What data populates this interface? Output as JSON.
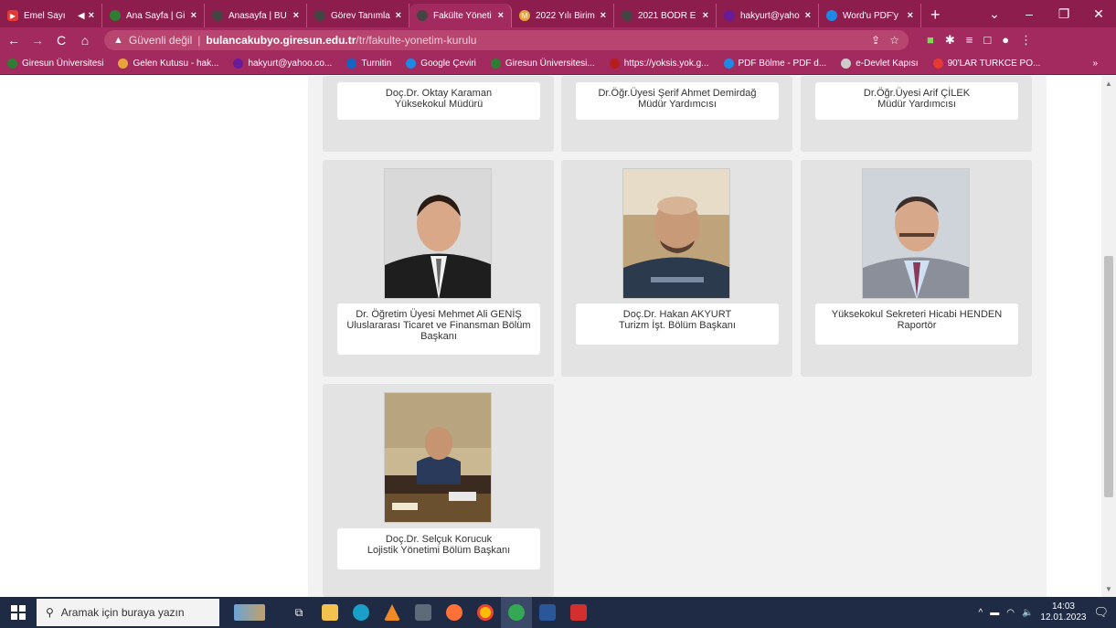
{
  "browser": {
    "tabs": [
      {
        "title": "Emel Sayı",
        "icon_color": "#e53935",
        "extra": "◀"
      },
      {
        "title": "Ana Sayfa | Gi",
        "icon_color": "#2e7d32"
      },
      {
        "title": "Anasayfa | BU",
        "icon_color": "#444444"
      },
      {
        "title": "Görev Tanımla",
        "icon_color": "#444444"
      },
      {
        "title": "Fakülte Yöneti",
        "icon_color": "#444444",
        "active": true
      },
      {
        "title": "2022 Yılı Birim",
        "icon_color": "#e8a33d"
      },
      {
        "title": "2021 BÖDR E",
        "icon_color": "#444444"
      },
      {
        "title": "hakyurt@yaho",
        "icon_color": "#6a1b9a"
      },
      {
        "title": "Word'u PDF'y",
        "icon_color": "#1e88e5"
      }
    ],
    "new_tab": "+",
    "address": {
      "warning_label": "Güvenli değil",
      "host": "bulancakubyo.giresun.edu.tr",
      "path": "/tr/fakulte-yonetim-kurulu"
    },
    "bookmarks": [
      {
        "label": "Giresun Üniversitesi",
        "icon_color": "#2e7d32"
      },
      {
        "label": "Gelen Kutusu - hak...",
        "icon_color": "#e8a33d"
      },
      {
        "label": "hakyurt@yahoo.co...",
        "icon_color": "#6a1b9a"
      },
      {
        "label": "Turnitin",
        "icon_color": "#1565c0"
      },
      {
        "label": "Google Çeviri",
        "icon_color": "#1e88e5"
      },
      {
        "label": "Giresun Üniversitesi...",
        "icon_color": "#2e7d32"
      },
      {
        "label": "https://yoksis.yok.g...",
        "icon_color": "#b71c1c"
      },
      {
        "label": "PDF Bölme - PDF d...",
        "icon_color": "#1e88e5"
      },
      {
        "label": "e-Devlet Kapısı",
        "icon_color": "#cccccc"
      },
      {
        "label": "90'LAR TURKCE PO...",
        "icon_color": "#e53935"
      }
    ],
    "bookmarks_more": "»"
  },
  "page": {
    "top_row": [
      {
        "line1": "Doç.Dr. Oktay Karaman",
        "line2": "Yüksekokul Müdürü"
      },
      {
        "line1": "Dr.Öğr.Üyesi Şerif Ahmet Demirdağ",
        "line2": "Müdür Yardımcısı"
      },
      {
        "line1": "Dr.Öğr.Üyesi Arif ÇİLEK",
        "line2": "Müdür Yardımcısı"
      }
    ],
    "middle_row": [
      {
        "line1": "Dr. Öğretim Üyesi Mehmet Ali GENİŞ",
        "line2": "Uluslararası Ticaret ve Finansman Bölüm",
        "line3": "Başkanı"
      },
      {
        "line1": "Doç.Dr. Hakan AKYURT",
        "line2": "Turizm İşt. Bölüm Başkanı"
      },
      {
        "line1": "Yüksekokul Sekreteri Hicabi HENDEN",
        "line2": "Raportör"
      }
    ],
    "bottom_row": [
      {
        "line1": "Doç.Dr. Selçuk Korucuk",
        "line2": "Lojistik Yönetimi Bölüm Başkanı"
      }
    ]
  },
  "taskbar": {
    "search_placeholder": "Aramak için buraya yazın",
    "time": "14:03",
    "date": "12.01.2023"
  }
}
